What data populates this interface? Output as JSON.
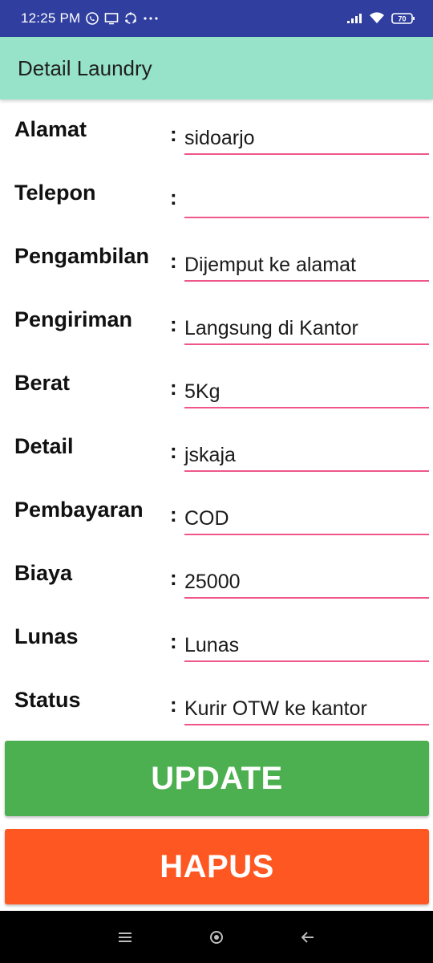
{
  "status_bar": {
    "time": "12:25 PM",
    "left_icons": [
      "whatsapp-icon",
      "screen-icon",
      "sync-icon",
      "more-dots-icon"
    ],
    "right_icons": [
      "signal-icon",
      "wifi-icon",
      "battery-icon"
    ],
    "battery_level": "70"
  },
  "app_bar": {
    "title": "Detail Laundry"
  },
  "fields": [
    {
      "label": "Alamat",
      "colon": ":",
      "value": "sidoarjo"
    },
    {
      "label": "Telepon",
      "colon": ":",
      "value": ""
    },
    {
      "label": "Pengambilan",
      "colon": ":",
      "value": "Dijemput ke alamat"
    },
    {
      "label": "Pengiriman",
      "colon": ":",
      "value": "Langsung di Kantor"
    },
    {
      "label": "Berat",
      "colon": ":",
      "value": "5Kg"
    },
    {
      "label": "Detail",
      "colon": ":",
      "value": "jskaja"
    },
    {
      "label": "Pembayaran",
      "colon": ":",
      "value": "COD"
    },
    {
      "label": "Biaya",
      "colon": ":",
      "value": "25000"
    },
    {
      "label": "Lunas",
      "colon": ":",
      "value": "Lunas"
    },
    {
      "label": "Status",
      "colon": ":",
      "value": "Kurir OTW ke kantor"
    }
  ],
  "buttons": {
    "update_label": "UPDATE",
    "delete_label": "HAPUS"
  },
  "colors": {
    "status_bar": "#303F9F",
    "app_bar": "#96E3CA",
    "underline": "#E91E63",
    "update_button": "#4CAF50",
    "delete_button": "#FF5722"
  },
  "nav_bar": {
    "icons": [
      "menu-icon",
      "home-icon",
      "back-icon"
    ]
  }
}
